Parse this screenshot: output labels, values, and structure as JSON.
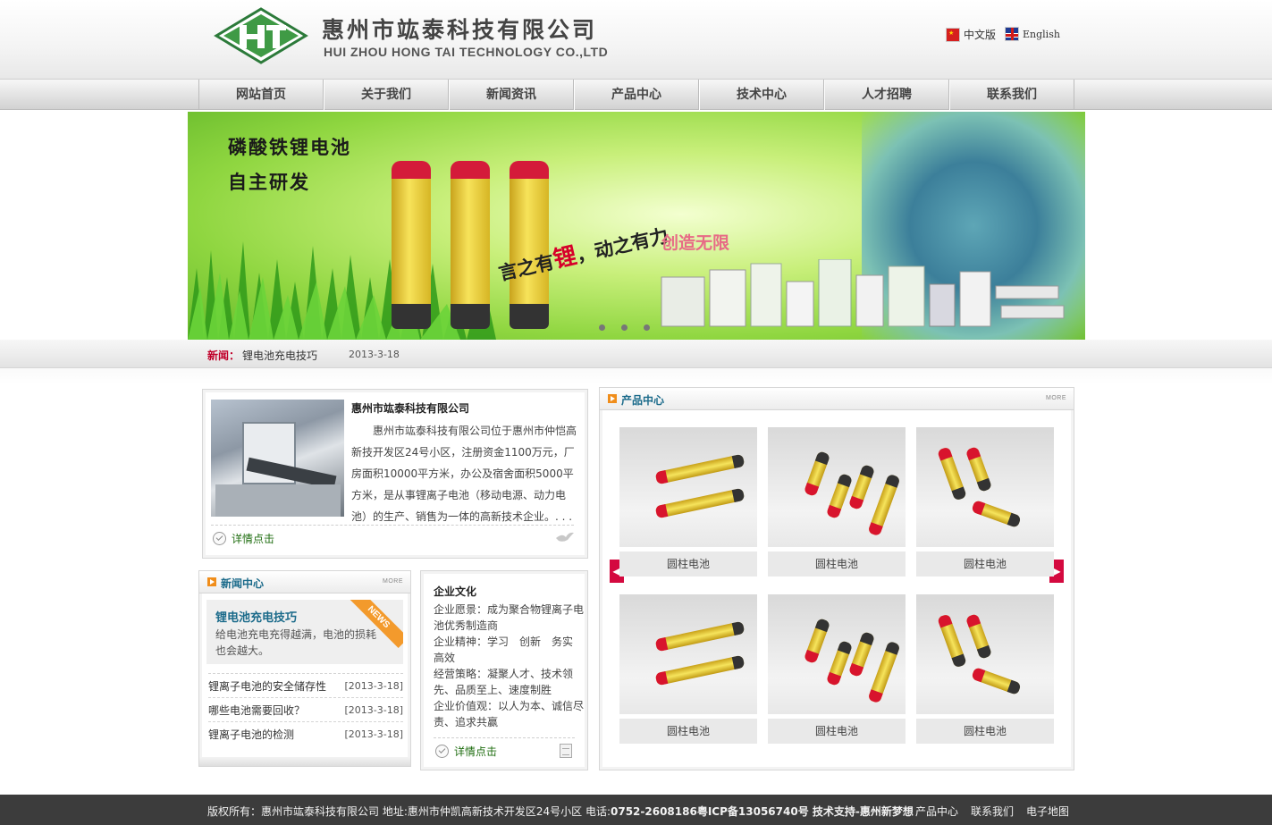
{
  "header": {
    "company_cn": "惠州市竑泰科技有限公司",
    "company_en": "HUI ZHOU HONG TAI TECHNOLOGY CO.,LTD",
    "lang_cn": "中文版",
    "lang_en": "English"
  },
  "nav": {
    "items": [
      "网站首页",
      "关于我们",
      "新闻资讯",
      "产品中心",
      "技术中心",
      "人才招聘",
      "联系我们"
    ]
  },
  "banner": {
    "line1": "磷酸铁锂电池",
    "line2": "自主研发",
    "slogan_a": "言之有",
    "slogan_red": "锂",
    "slogan_b": "，动之有力",
    "slogan2": "创造无限"
  },
  "ticker": {
    "label": "新闻：",
    "title": "锂电池充电技巧",
    "date": "2013-3-18"
  },
  "intro": {
    "title": "惠州市竑泰科技有限公司",
    "text": "惠州市竑泰科技有限公司位于惠州市仲恺高新技开发区24号小区，注册资金1100万元，厂房面积10000平方米，办公及宿舍面积5000平方米，是从事锂离子电池（移动电源、动力电池）的生产、销售为一体的高新技术企业。. . .",
    "more": "详情点击"
  },
  "news": {
    "title": "新闻中心",
    "more": "MORE",
    "ribbon": "NEWS",
    "feature_title": "锂电池充电技巧",
    "feature_desc": "给电池充电充得越满，电池的损耗也会越大。",
    "items": [
      {
        "title": "锂离子电池的安全储存性",
        "date": "[2013-3-18]"
      },
      {
        "title": "哪些电池需要回收？",
        "date": "[2013-3-18]"
      },
      {
        "title": "锂离子电池的检测",
        "date": "[2013-3-18]"
      }
    ]
  },
  "culture": {
    "title": "企业文化",
    "text": "企业愿景：成为聚合物锂离子电池优秀制造商\n企业精神：学习　创新　务实　高效\n经营策略：凝聚人才、技术领先、品质至上、速度制胜\n企业价值观：以人为本、诚信尽责、追求共赢",
    "more": "详情点击"
  },
  "products": {
    "title": "产品中心",
    "more": "MORE",
    "items": [
      {
        "caption": "圆柱电池"
      },
      {
        "caption": "圆柱电池"
      },
      {
        "caption": "圆柱电池"
      },
      {
        "caption": "圆柱电池"
      },
      {
        "caption": "圆柱电池"
      },
      {
        "caption": "圆柱电池"
      }
    ]
  },
  "footer": {
    "part1": "版权所有：惠州市竑泰科技有限公司 地址:惠州市仲凯高新技术开发区24号小区 电话:",
    "part2": "0752-2608186粤ICP备13056740号  技术支持-惠州新梦想",
    "links": [
      "产品中心",
      "联系我们",
      "电子地图"
    ]
  },
  "colors": {
    "accent_red": "#d4093f",
    "title_blue": "#1a6a8a",
    "ticker_red": "#c0002a",
    "footer_bg": "#3c3c3c"
  }
}
